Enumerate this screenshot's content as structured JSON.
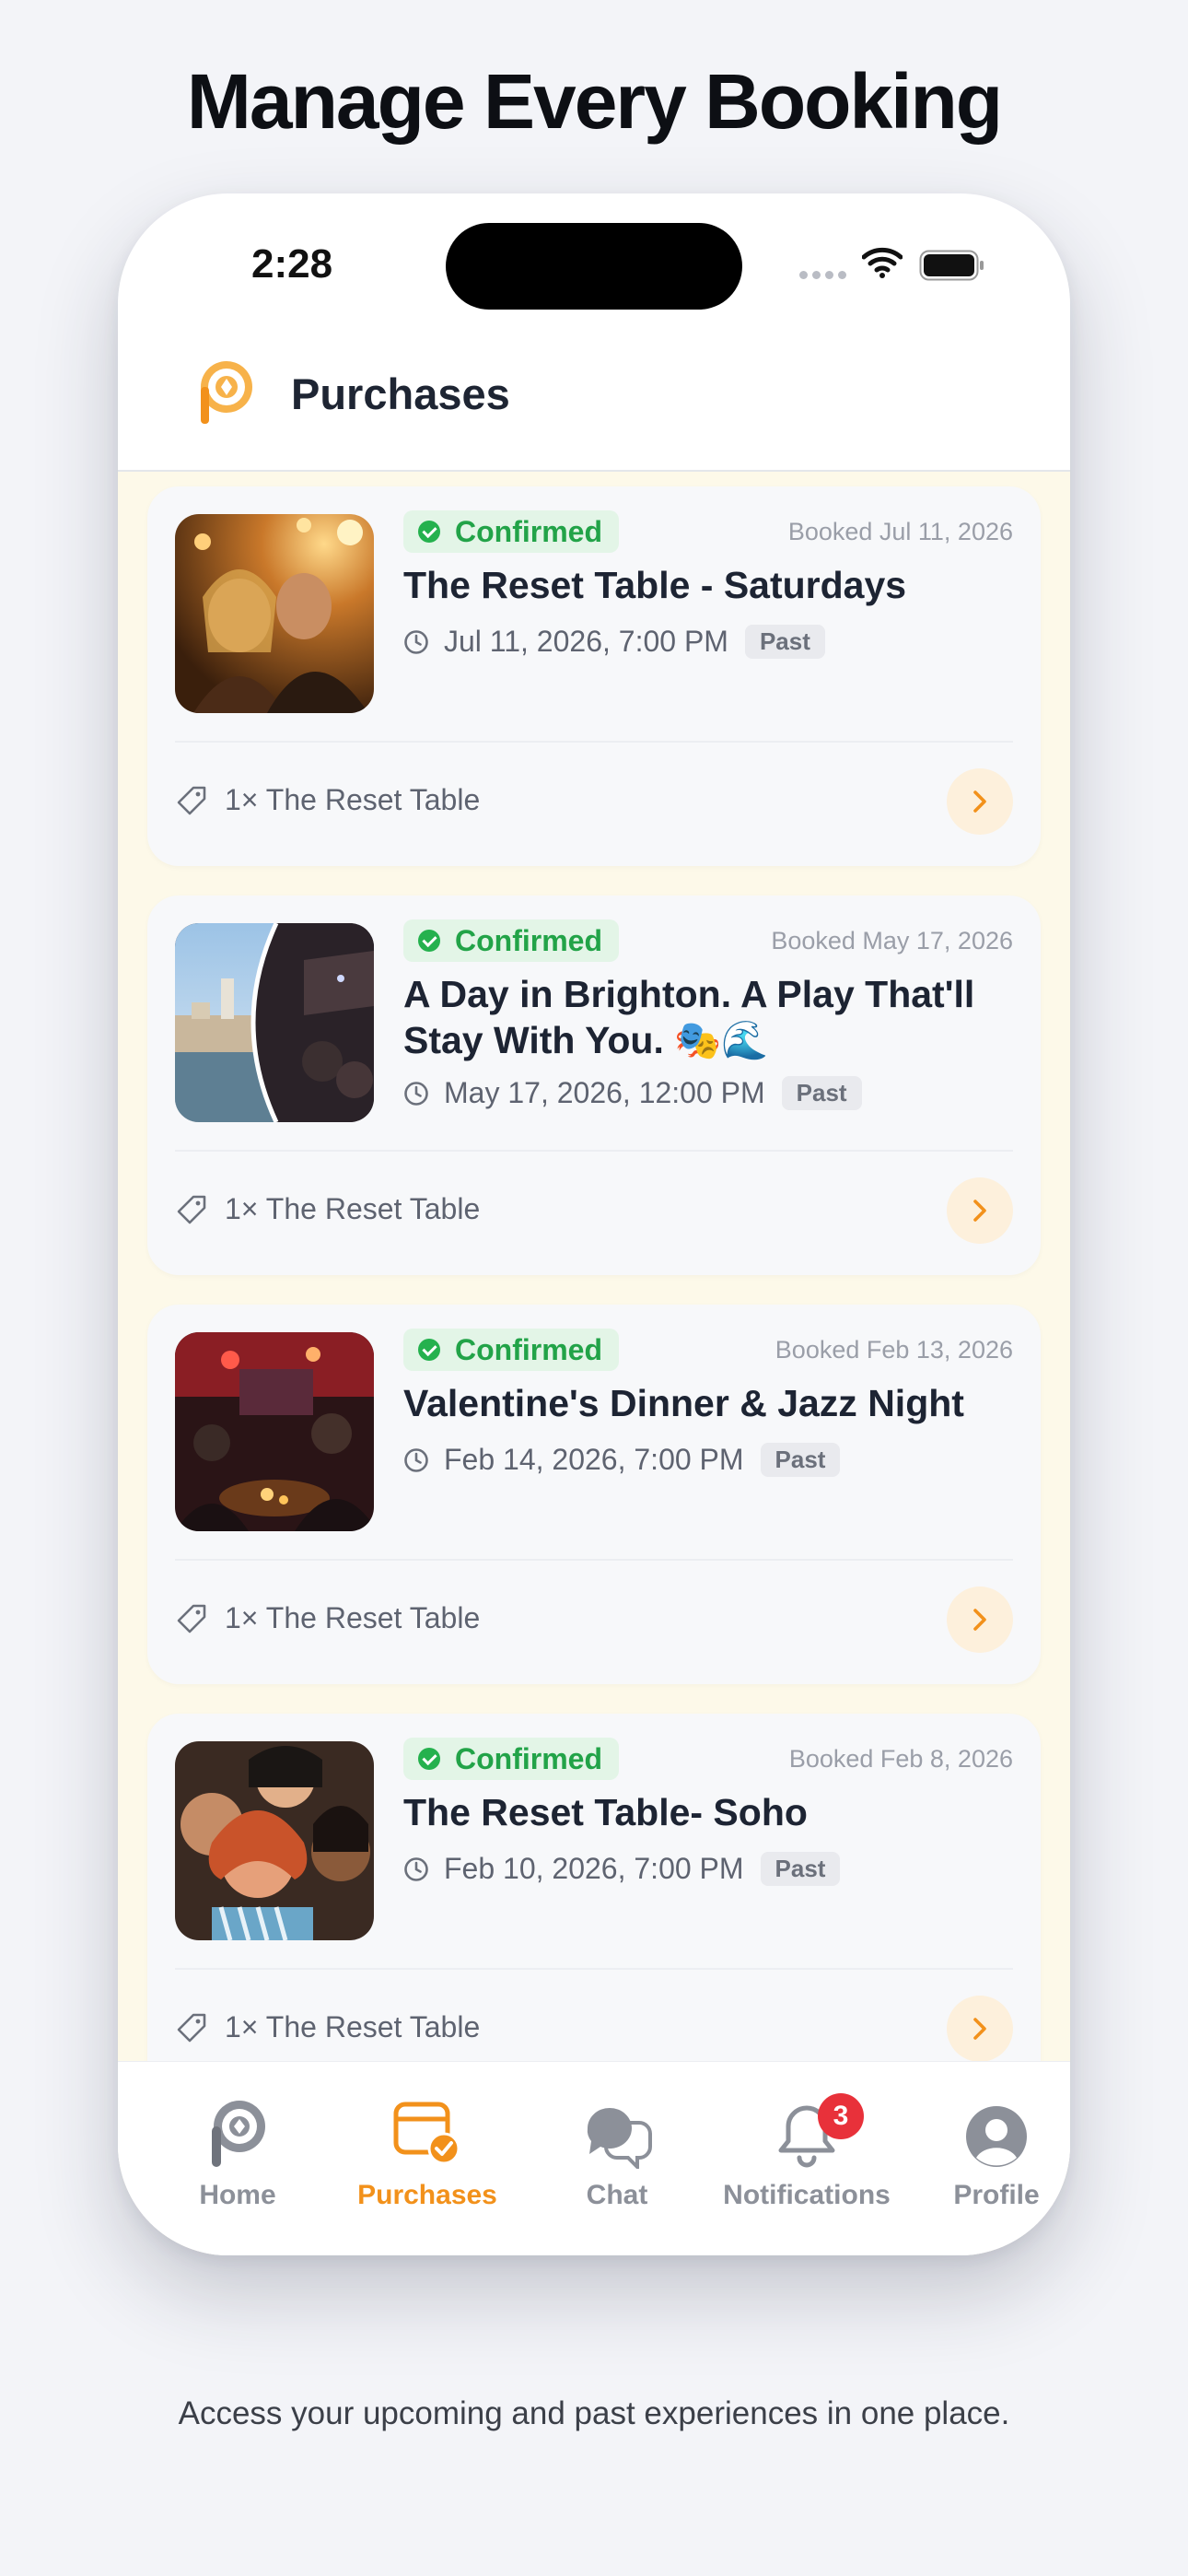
{
  "headline": "Manage Every Booking",
  "caption": "Access your upcoming and past experiences in one place.",
  "status_bar": {
    "time": "2:28"
  },
  "app_header": {
    "title": "Purchases"
  },
  "colors": {
    "accent": "#f2911b",
    "confirmed_green": "#22a348",
    "list_background": "#fdf9e9",
    "notification_red": "#e8313a"
  },
  "purchases": [
    {
      "status": "Confirmed",
      "booked": "Booked Jul 11, 2026",
      "title": "The Reset Table - Saturdays",
      "datetime": "Jul 11, 2026, 7:00 PM",
      "tag": "Past",
      "ticket": "1× The Reset Table",
      "image": "friends-bar-photo"
    },
    {
      "status": "Confirmed",
      "booked": "Booked May 17, 2026",
      "title": "A Day in Brighton. A Play That'll Stay With You. 🎭🌊",
      "datetime": "May 17, 2026, 12:00 PM",
      "tag": "Past",
      "ticket": "1× The Reset Table",
      "image": "brighton-theatre-photo"
    },
    {
      "status": "Confirmed",
      "booked": "Booked Feb 13, 2026",
      "title": "Valentine's Dinner & Jazz Night",
      "datetime": "Feb 14, 2026, 7:00 PM",
      "tag": "Past",
      "ticket": "1× The Reset Table",
      "image": "jazz-bar-photo"
    },
    {
      "status": "Confirmed",
      "booked": "Booked Feb 8, 2026",
      "title": "The Reset Table- Soho",
      "datetime": "Feb 10, 2026, 7:00 PM",
      "tag": "Past",
      "ticket": "1× The Reset Table",
      "image": "group-selfie-photo"
    }
  ],
  "tabbar": {
    "home": "Home",
    "purchases": "Purchases",
    "chat": "Chat",
    "notifications": "Notifications",
    "notifications_count": "3",
    "profile": "Profile",
    "active": "purchases"
  }
}
